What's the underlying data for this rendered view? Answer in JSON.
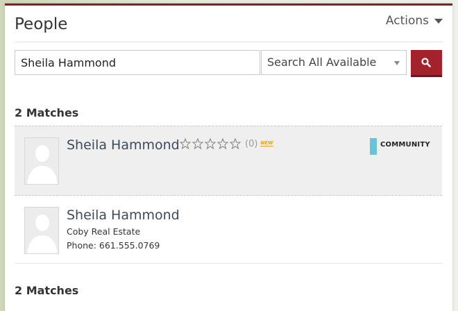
{
  "panel": {
    "title": "People",
    "actions_label": "Actions"
  },
  "search": {
    "query": "Sheila Hammond",
    "scope_selected": "Search All Available",
    "button_icon": "search-icon"
  },
  "matches_label": "2 Matches",
  "results": [
    {
      "name": "Sheila Hammond",
      "rating_count": "(0)",
      "stars_filled": 0,
      "stars_total": 5,
      "new_badge": "NEW",
      "tag": "COMMUNITY",
      "tag_color": "#6ac4d8",
      "highlighted": true
    },
    {
      "name": "Sheila Hammond",
      "company": "Coby Real Estate",
      "phone": "Phone: 661.555.0769",
      "highlighted": false
    }
  ],
  "colors": {
    "accent": "#8b1a26",
    "button": "#a3222c",
    "name_text": "#3c4b5a"
  }
}
